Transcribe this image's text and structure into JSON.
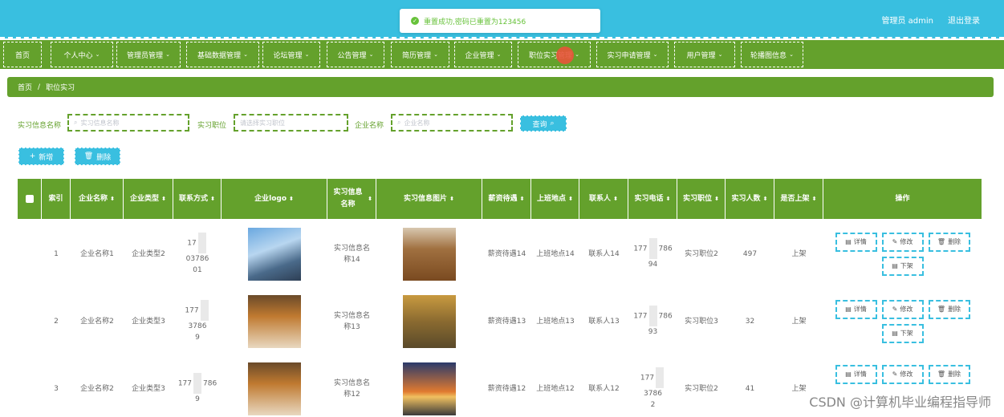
{
  "header": {
    "user": "管理员 admin",
    "logout": "退出登录"
  },
  "toast": {
    "message": "重置成功,密码已重置为123456"
  },
  "nav": [
    {
      "label": "首页",
      "chevron": ""
    },
    {
      "label": "个人中心",
      "chevron": "⌄"
    },
    {
      "label": "管理员管理",
      "chevron": "⌄"
    },
    {
      "label": "基础数据管理",
      "chevron": "⌄"
    },
    {
      "label": "论坛管理",
      "chevron": "⌄"
    },
    {
      "label": "公告管理",
      "chevron": "⌄"
    },
    {
      "label": "简历管理",
      "chevron": "⌄"
    },
    {
      "label": "企业管理",
      "chevron": "⌄"
    },
    {
      "label": "职位实习管理",
      "chevron": "⌄"
    },
    {
      "label": "实习申请管理",
      "chevron": "⌄"
    },
    {
      "label": "用户管理",
      "chevron": "⌄"
    },
    {
      "label": "轮播图信息",
      "chevron": "⌄"
    }
  ],
  "breadcrumb": {
    "home": "首页",
    "sep": "/",
    "current": "职位实习"
  },
  "search": {
    "f1_label": "实习信息名称",
    "f1_placeholder": "实习信息名称",
    "f2_label": "实习职位",
    "f2_placeholder": "请选择实习职位",
    "f3_label": "企业名称",
    "f3_placeholder": "企业名称",
    "query": "查询"
  },
  "actions": {
    "add": "新增",
    "delete": "删除"
  },
  "columns": {
    "index": "索引",
    "company_name": "企业名称",
    "company_type": "企业类型",
    "contact": "联系方式",
    "logo": "企业logo",
    "intern_name": "实习信息名称",
    "intern_image": "实习信息图片",
    "salary": "薪资待遇",
    "location": "上班地点",
    "contact_person": "联系人",
    "phone": "实习电话",
    "position": "实习职位",
    "count": "实习人数",
    "listed": "是否上架",
    "ops": "操作"
  },
  "rows": [
    {
      "index": "1",
      "company_name": "企业名称1",
      "company_type": "企业类型2",
      "contact_a": "17",
      "contact_b": "03786",
      "contact_c": "01",
      "intern_name": "实习信息名称14",
      "salary": "薪资待遇14",
      "location": "上班地点14",
      "contact_person": "联系人14",
      "phone_a": "177",
      "phone_b": "786",
      "phone_c": "9",
      "phone_d": "4",
      "position": "实习职位2",
      "count": "497",
      "listed": "上架"
    },
    {
      "index": "2",
      "company_name": "企业名称2",
      "company_type": "企业类型3",
      "contact_a": "177",
      "contact_b": "3786",
      "contact_c": "9",
      "intern_name": "实习信息名称13",
      "salary": "薪资待遇13",
      "location": "上班地点13",
      "contact_person": "联系人13",
      "phone_a": "177",
      "phone_b": "786",
      "phone_c": "9",
      "phone_d": "3",
      "position": "实习职位3",
      "count": "32",
      "listed": "上架"
    },
    {
      "index": "3",
      "company_name": "企业名称2",
      "company_type": "企业类型3",
      "contact_a": "177",
      "contact_b": "786",
      "contact_c": "9",
      "intern_name": "实习信息名称12",
      "salary": "薪资待遇12",
      "location": "上班地点12",
      "contact_person": "联系人12",
      "phone_a": "177",
      "phone_b": "3786",
      "phone_c": "",
      "phone_d": "2",
      "position": "实习职位2",
      "count": "41",
      "listed": "上架"
    }
  ],
  "row_ops": {
    "detail": "详情",
    "edit": "修改",
    "remove": "删除",
    "offshelf": "下架"
  },
  "watermark": "CSDN @计算机毕业编程指导师",
  "colors": {
    "topbar": "#39bfe0",
    "primary": "#64a12c",
    "success": "#67c23a"
  },
  "icons": {
    "success": "check-circle-icon",
    "search": "search-icon",
    "add": "plus-icon",
    "delete": "trash-icon",
    "sort": "sort-icon",
    "detail": "document-icon",
    "edit": "pencil-icon",
    "offshelf": "document-icon"
  }
}
